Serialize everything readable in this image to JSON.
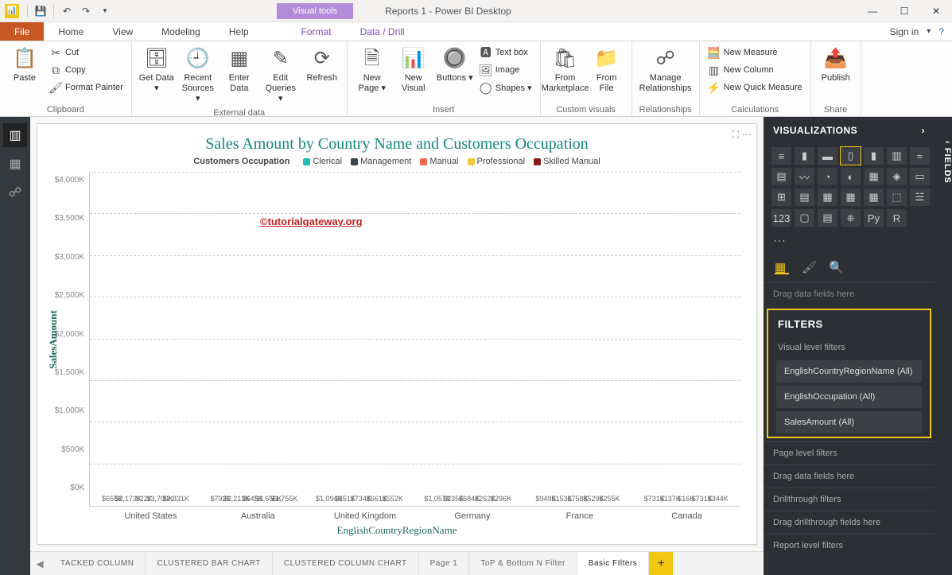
{
  "titlebar": {
    "visual_tools": "Visual tools",
    "app_title": "Reports 1 - Power BI Desktop"
  },
  "menu": {
    "file": "File",
    "tabs": [
      "Home",
      "View",
      "Modeling",
      "Help"
    ],
    "ctx_tabs": [
      "Format",
      "Data / Drill"
    ],
    "signin": "Sign in"
  },
  "ribbon": {
    "clipboard": {
      "paste": "Paste",
      "cut": "Cut",
      "copy": "Copy",
      "fmt": "Format Painter",
      "label": "Clipboard"
    },
    "ext": {
      "get": "Get Data ▾",
      "recent": "Recent Sources ▾",
      "enter": "Enter Data",
      "edit": "Edit Queries ▾",
      "refresh": "Refresh",
      "label": "External data"
    },
    "insert": {
      "newpage": "New Page ▾",
      "newvis": "New Visual",
      "buttons": "Buttons ▾",
      "text": "Text box",
      "image": "Image",
      "shapes": "Shapes ▾",
      "label": "Insert"
    },
    "custom": {
      "market": "From Marketplace",
      "file": "From File",
      "label": "Custom visuals"
    },
    "rel": {
      "manage": "Manage Relationships",
      "label": "Relationships"
    },
    "calc": {
      "nm": "New Measure",
      "nc": "New Column",
      "nqm": "New Quick Measure",
      "label": "Calculations"
    },
    "share": {
      "publish": "Publish",
      "label": "Share"
    }
  },
  "chart_data": {
    "type": "bar",
    "title": "Sales Amount by Country Name and Customers Occupation",
    "legend_title": "Customers Occupation",
    "xlabel": "EnglishCountryRegionName",
    "ylabel": "SalesAmount",
    "ylim": [
      0,
      4000
    ],
    "yticks": [
      "$0K",
      "$500K",
      "$1,000K",
      "$1,500K",
      "$2,000K",
      "$2,500K",
      "$3,000K",
      "$3,500K",
      "$4,000K"
    ],
    "series": [
      {
        "name": "Clerical",
        "color": "#1fbeb0"
      },
      {
        "name": "Management",
        "color": "#36454f"
      },
      {
        "name": "Manual",
        "color": "#ef6850"
      },
      {
        "name": "Professional",
        "color": "#f2c83a"
      },
      {
        "name": "Skilled Manual",
        "color": "#8a1b1b"
      }
    ],
    "categories": [
      "United States",
      "Australia",
      "United Kingdom",
      "Germany",
      "France",
      "Canada"
    ],
    "values": [
      {
        "Clerical": 655,
        "Management": 2173,
        "Manual": 22,
        "Professional": 3709,
        "Skilled Manual": 2831
      },
      {
        "Clerical": 792,
        "Management": 2213,
        "Manual": 645,
        "Professional": 3656,
        "Skilled Manual": 1755
      },
      {
        "Clerical": 1094,
        "Management": 351,
        "Manual": 734,
        "Professional": 661,
        "Skilled Manual": 552
      },
      {
        "Clerical": 1057,
        "Management": 235,
        "Manual": 684,
        "Professional": 262,
        "Skilled Manual": 296
      },
      {
        "Clerical": 949,
        "Management": 153,
        "Manual": 758,
        "Professional": 529,
        "Skilled Manual": 255
      },
      {
        "Clerical": 731,
        "Management": 137,
        "Manual": 16,
        "Professional": 731,
        "Skilled Manual": 344
      }
    ],
    "labels": [
      [
        "$655K",
        "$2,173K",
        "$22K",
        "$3,709K",
        "$2,831K"
      ],
      [
        "$792K",
        "$2,213K",
        "$645K",
        "$3,656K",
        "$1,755K"
      ],
      [
        "$1,094K",
        "$351K",
        "$734K",
        "$661K",
        "$552K"
      ],
      [
        "$1,057K",
        "$235K",
        "$684K",
        "$262K",
        "$296K"
      ],
      [
        "$949K",
        "$153K",
        "$758K",
        "$529K",
        "$255K"
      ],
      [
        "$731K",
        "$137K",
        "$16K",
        "$731K",
        "$344K"
      ]
    ]
  },
  "watermark": "©tutorialgateway.org",
  "pagetabs": [
    "TACKED COLUMN",
    "CLUSTERED BAR CHART",
    "CLUSTERED COLUMN CHART",
    "Page 1",
    "ToP & Bottom N Filter",
    "Basic FIlters"
  ],
  "vis": {
    "hdr": "VISUALIZATIONS",
    "drag": "Drag data fields here",
    "filters_hdr": "FILTERS",
    "vlf": "Visual level filters",
    "items": [
      "EnglishCountryRegionName  (All)",
      "EnglishOccupation  (All)",
      "SalesAmount  (All)"
    ],
    "plf": "Page level filters",
    "drag2": "Drag data fields here",
    "dtf": "Drillthrough filters",
    "drag3": "Drag drillthrough fields here",
    "rlf": "Report level filters"
  },
  "fields": "FIELDS"
}
